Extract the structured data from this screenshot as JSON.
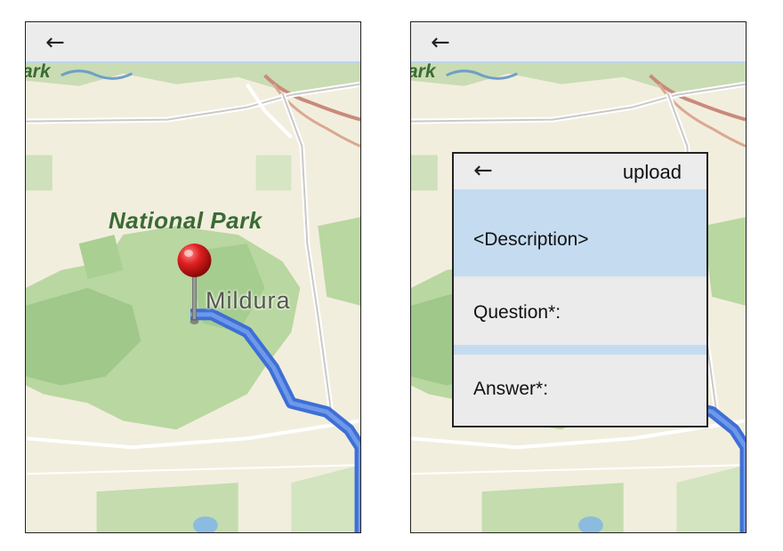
{
  "left_screen": {
    "back_icon": "←",
    "map": {
      "park_label": "National Park",
      "city_label": "Mildura",
      "edge_label": "ark"
    }
  },
  "right_screen": {
    "back_icon": "←",
    "map": {
      "edge_label": "ark"
    },
    "dialog": {
      "back_icon": "←",
      "upload_label": "upload",
      "description": "<Description>",
      "question_label": "Question*:",
      "answer_label": "Answer*:"
    }
  },
  "colors": {
    "map_base": "#f2eede",
    "park_green": "#b9d7a0",
    "park_green_dark": "#9fc88a",
    "route_blue": "#3d6fd6",
    "pin_red": "#d41a1a",
    "topbar": "#ececec",
    "dialog_highlight": "#c5dcf0"
  }
}
